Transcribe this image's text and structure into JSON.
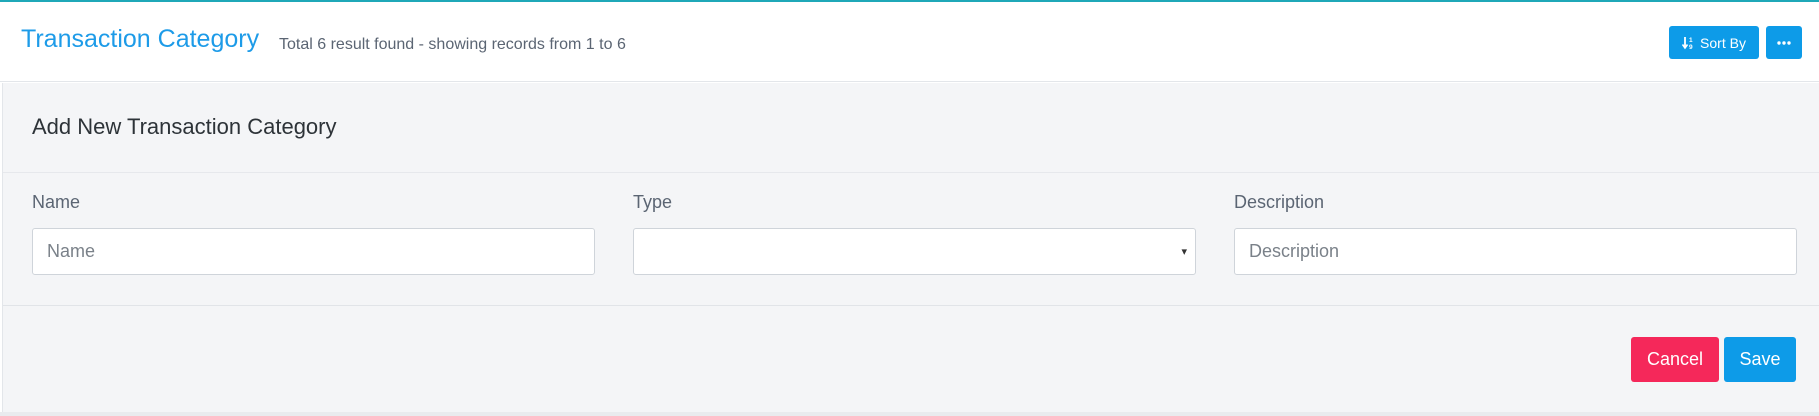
{
  "header": {
    "title": "Transaction Category",
    "result_summary": "Total 6 result found - showing records from 1 to 6",
    "sort_label": "Sort By",
    "sort_icon": "sort-numeric-icon",
    "more_icon": "ellipsis-icon"
  },
  "form": {
    "title": "Add New Transaction Category",
    "fields": [
      {
        "label": "Name",
        "placeholder": "Name",
        "value": ""
      },
      {
        "label": "Type",
        "value": ""
      },
      {
        "label": "Description",
        "placeholder": "Description",
        "value": ""
      }
    ],
    "cancel_label": "Cancel",
    "save_label": "Save"
  },
  "colors": {
    "accent": "#0d9be8",
    "title": "#1d9be8",
    "danger": "#f5285a",
    "top_border": "#1fa8b8",
    "panel_bg": "#f4f5f7"
  }
}
